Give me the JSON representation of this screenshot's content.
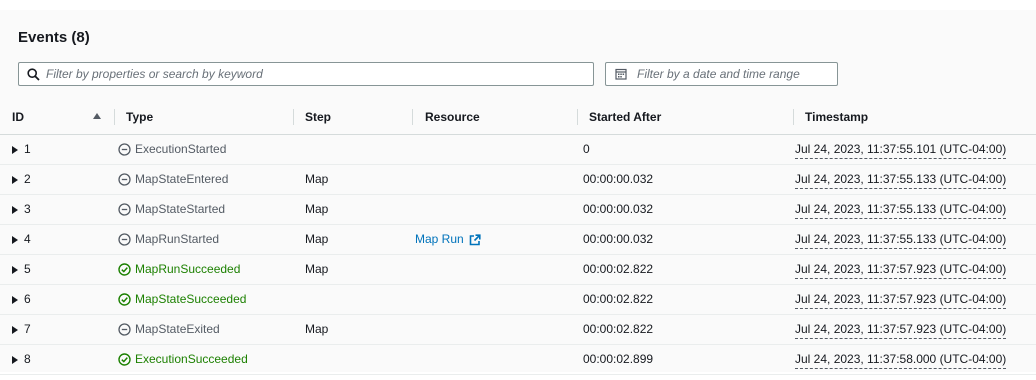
{
  "header": {
    "title": "Events (8)"
  },
  "search": {
    "placeholder": "Filter by properties or search by keyword"
  },
  "date_filter": {
    "placeholder": "Filter by a date and time range"
  },
  "columns": {
    "id": "ID",
    "type": "Type",
    "step": "Step",
    "resource": "Resource",
    "started_after": "Started After",
    "timestamp": "Timestamp"
  },
  "colors": {
    "gray_status": "#545b64",
    "success": "#1d8102",
    "link": "#0073bb"
  },
  "rows": [
    {
      "id": "1",
      "type": "ExecutionStarted",
      "status": "neutral",
      "step": "",
      "resource": "",
      "started_after": "0",
      "timestamp": "Jul 24, 2023, 11:37:55.101 (UTC-04:00)"
    },
    {
      "id": "2",
      "type": "MapStateEntered",
      "status": "neutral",
      "step": "Map",
      "resource": "",
      "started_after": "00:00:00.032",
      "timestamp": "Jul 24, 2023, 11:37:55.133 (UTC-04:00)"
    },
    {
      "id": "3",
      "type": "MapStateStarted",
      "status": "neutral",
      "step": "Map",
      "resource": "",
      "started_after": "00:00:00.032",
      "timestamp": "Jul 24, 2023, 11:37:55.133 (UTC-04:00)"
    },
    {
      "id": "4",
      "type": "MapRunStarted",
      "status": "neutral",
      "step": "Map",
      "resource": "Map Run",
      "started_after": "00:00:00.032",
      "timestamp": "Jul 24, 2023, 11:37:55.133 (UTC-04:00)"
    },
    {
      "id": "5",
      "type": "MapRunSucceeded",
      "status": "success",
      "step": "Map",
      "resource": "",
      "started_after": "00:00:02.822",
      "timestamp": "Jul 24, 2023, 11:37:57.923 (UTC-04:00)"
    },
    {
      "id": "6",
      "type": "MapStateSucceeded",
      "status": "success",
      "step": "",
      "resource": "",
      "started_after": "00:00:02.822",
      "timestamp": "Jul 24, 2023, 11:37:57.923 (UTC-04:00)"
    },
    {
      "id": "7",
      "type": "MapStateExited",
      "status": "neutral",
      "step": "Map",
      "resource": "",
      "started_after": "00:00:02.822",
      "timestamp": "Jul 24, 2023, 11:37:57.923 (UTC-04:00)"
    },
    {
      "id": "8",
      "type": "ExecutionSucceeded",
      "status": "success",
      "step": "",
      "resource": "",
      "started_after": "00:00:02.899",
      "timestamp": "Jul 24, 2023, 11:37:58.000 (UTC-04:00)"
    }
  ]
}
